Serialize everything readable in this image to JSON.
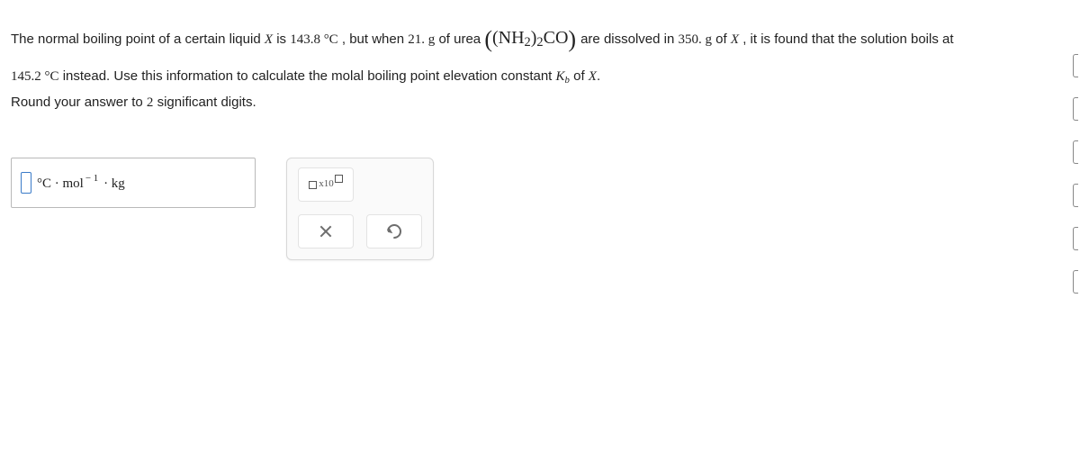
{
  "problem": {
    "p1a": "The normal boiling point of a certain liquid ",
    "varX": "X",
    "p1b": " is ",
    "bp_pure": "143.8 °C",
    "p1c": ", but when ",
    "mass_solute": "21. g",
    "p1d": " of urea ",
    "formula_open": "(",
    "formula_inner_open": "(",
    "nh": "NH",
    "nh_sub": "2",
    "formula_inner_close": ")",
    "outer_sub": "2",
    "co": "CO",
    "formula_close": ")",
    "p1e": " are dissolved in ",
    "mass_solvent": "350. g",
    "p1f": " of ",
    "p1g": ", it is found that the solution boils at",
    "p2a": "",
    "bp_soln": "145.2 °C",
    "p2b": " instead. Use this information to calculate the molal boiling point elevation constant ",
    "kb": "K",
    "kb_sub": "b",
    "p2c": " of ",
    "p2d": ".",
    "instruction": "Round your answer to 2 significant digits."
  },
  "answer": {
    "unit_deg": "°C · mol",
    "unit_exp": "− 1",
    "unit_kg": " · kg"
  },
  "buttons": {
    "sci_x10": "x10",
    "clear": "clear",
    "reset": "reset"
  }
}
